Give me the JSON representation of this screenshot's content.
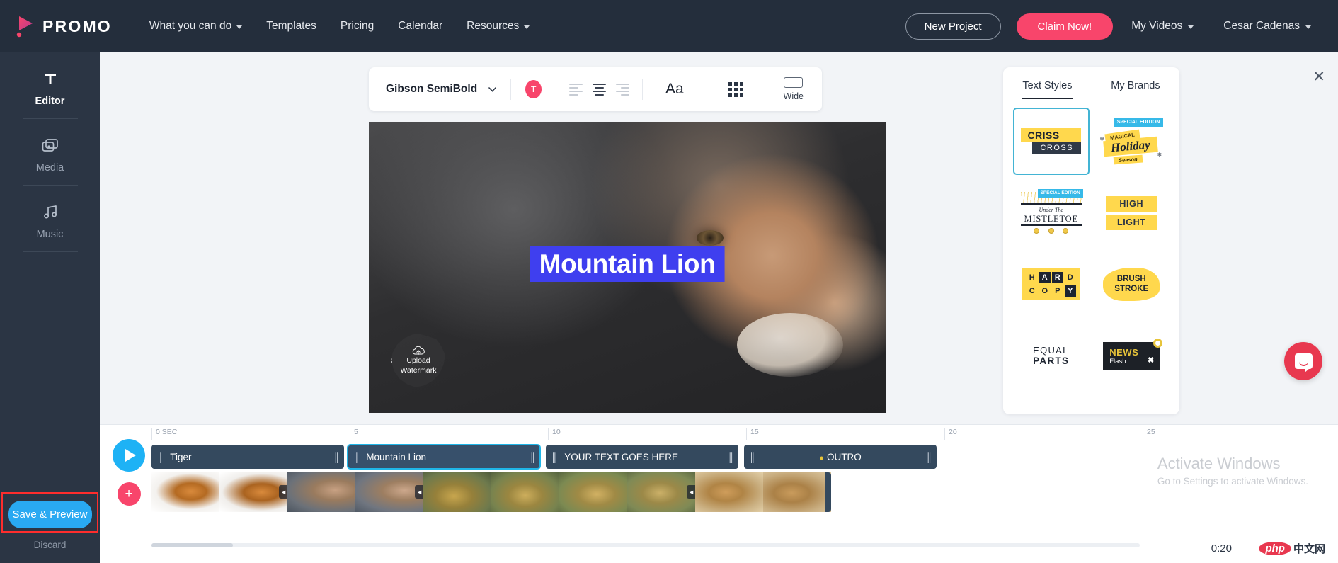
{
  "brand": {
    "name": "PROMO",
    "accent": "#f8456b",
    "logo_icon": "promo-play-logo"
  },
  "topnav": {
    "links": [
      {
        "label": "What you can do",
        "has_caret": true
      },
      {
        "label": "Templates",
        "has_caret": false
      },
      {
        "label": "Pricing",
        "has_caret": false
      },
      {
        "label": "Calendar",
        "has_caret": false
      },
      {
        "label": "Resources",
        "has_caret": true
      }
    ],
    "new_project": "New Project",
    "claim_now": "Claim Now!",
    "my_videos": "My Videos",
    "user": "Cesar Cadenas"
  },
  "sidebar": {
    "items": [
      {
        "label": "Editor",
        "icon": "text-t-icon",
        "active": true
      },
      {
        "label": "Media",
        "icon": "media-stack-icon",
        "active": false
      },
      {
        "label": "Music",
        "icon": "music-note-icon",
        "active": false
      }
    ],
    "save_preview": "Save & Preview",
    "discard": "Discard",
    "save_button_color": "#29a9f2",
    "highlight_color": "#ff2d2d"
  },
  "toolbar": {
    "font_name": "Gibson SemiBold",
    "color_swatch": "#f8456b",
    "color_glyph": "T",
    "align_options": [
      "align-left",
      "align-center",
      "align-right"
    ],
    "align_selected": "align-center",
    "text_size_label": "Aa",
    "grid_icon": "grid-dots-icon",
    "wide_label": "Wide"
  },
  "canvas": {
    "text_value": "Mountain Lion",
    "text_highlight_color": "#3f3fef",
    "watermark_label_line1": "Upload",
    "watermark_label_line2": "Watermark",
    "watermark_icon": "cloud-upload-icon"
  },
  "right_panel": {
    "tabs": [
      {
        "label": "Text Styles",
        "active": true
      },
      {
        "label": "My Brands",
        "active": false
      }
    ],
    "close_icon": "close-icon",
    "styles": [
      {
        "id": "criss-cross",
        "line1": "CRISS",
        "line2": "CROSS",
        "selected": true
      },
      {
        "id": "magical-holiday",
        "special": "SPECIAL EDITION",
        "line1": "MAGICAL",
        "line2": "Holiday",
        "line3": "Season",
        "selected": false
      },
      {
        "id": "under-the-mistletoe",
        "special": "SPECIAL EDITION",
        "line1": "Under The",
        "line2": "MISTLETOE",
        "selected": false
      },
      {
        "id": "high-light",
        "line1": "HIGH",
        "line2": "LIGHT",
        "selected": false
      },
      {
        "id": "hard-copy",
        "line1": "HARD",
        "line2": "COPY",
        "selected": false
      },
      {
        "id": "brush-stroke",
        "line1": "BRUSH",
        "line2": "STROKE",
        "selected": false
      },
      {
        "id": "equal-parts",
        "line1": "EQUAL",
        "line2": "PARTS",
        "selected": false
      },
      {
        "id": "news-flash",
        "line1": "NEWS",
        "line2": "Flash",
        "close_glyph": "✖",
        "selected": false
      }
    ]
  },
  "timeline": {
    "play_icon": "play-icon",
    "add_icon": "plus-icon",
    "ruler_ticks": [
      {
        "label": "0 SEC",
        "seconds": 0
      },
      {
        "label": "5",
        "seconds": 5
      },
      {
        "label": "10",
        "seconds": 10
      },
      {
        "label": "15",
        "seconds": 15
      },
      {
        "label": "20",
        "seconds": 20
      },
      {
        "label": "25",
        "seconds": 25
      }
    ],
    "clips": [
      {
        "label": "Tiger",
        "start": 0,
        "end": 5,
        "selected": false,
        "centered": false,
        "dot": false
      },
      {
        "label": "Mountain Lion",
        "start": 5,
        "end": 10,
        "selected": true,
        "centered": false,
        "dot": false
      },
      {
        "label": "YOUR TEXT GOES HERE",
        "start": 10,
        "end": 15,
        "selected": false,
        "centered": false,
        "dot": false
      },
      {
        "label": "OUTRO",
        "start": 15,
        "end": 20,
        "selected": false,
        "centered": true,
        "dot": true
      }
    ],
    "transition_icon": "transition-icon",
    "current_time": "0:20"
  },
  "os_notice": {
    "title": "Activate Windows",
    "subtitle": "Go to Settings to activate Windows."
  },
  "watermark": {
    "logo": "php",
    "text": "中文网"
  },
  "chat": {
    "icon": "chat-bubble-icon",
    "color": "#e8384f"
  }
}
